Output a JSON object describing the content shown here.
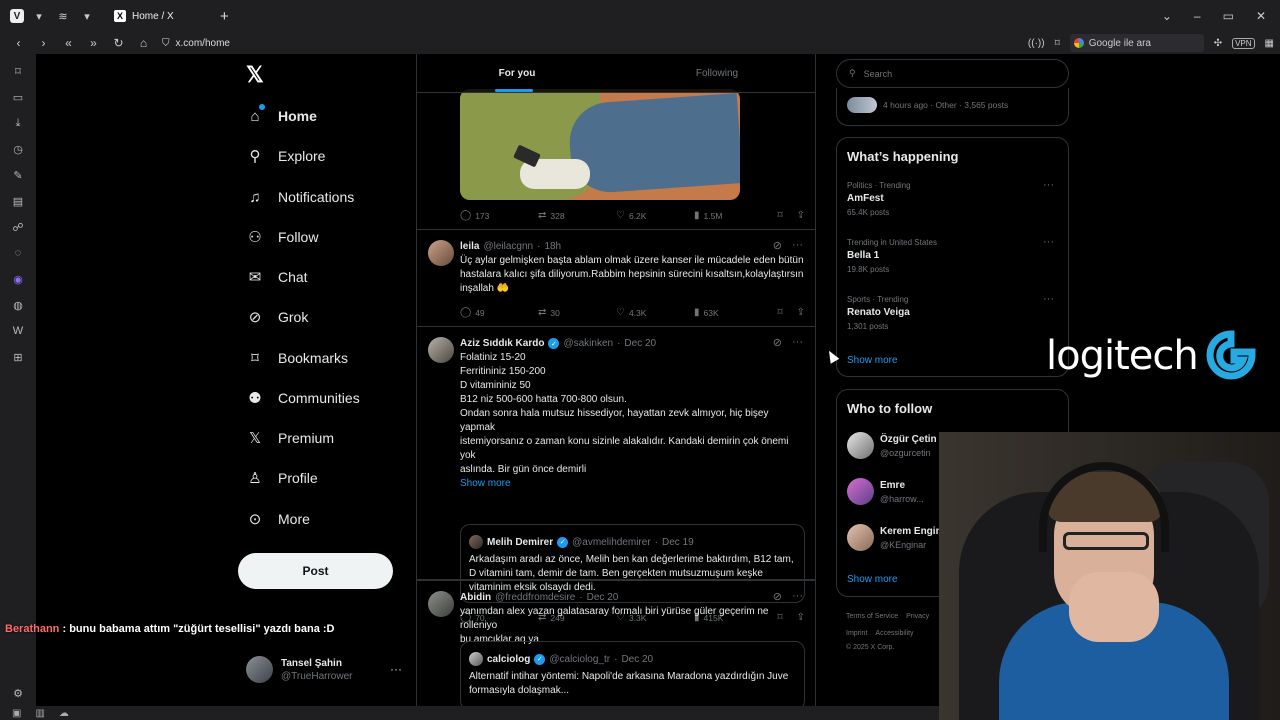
{
  "browser": {
    "tab_title": "Home / X",
    "url": "x.com/home",
    "search_placeholder": "Google ile ara",
    "vpn_label": "VPN"
  },
  "nav": {
    "items": [
      {
        "label": "Home",
        "icon": "home-icon"
      },
      {
        "label": "Explore",
        "icon": "search-icon"
      },
      {
        "label": "Notifications",
        "icon": "bell-icon"
      },
      {
        "label": "Follow",
        "icon": "person-add-icon"
      },
      {
        "label": "Chat",
        "icon": "mail-icon"
      },
      {
        "label": "Grok",
        "icon": "grok-icon"
      },
      {
        "label": "Bookmarks",
        "icon": "bookmark-icon"
      },
      {
        "label": "Communities",
        "icon": "people-icon"
      },
      {
        "label": "Premium",
        "icon": "x-icon"
      },
      {
        "label": "Profile",
        "icon": "person-icon"
      },
      {
        "label": "More",
        "icon": "more-circle-icon"
      }
    ],
    "post_label": "Post",
    "account": {
      "name": "Tansel Şahin",
      "handle": "@TrueHarrower"
    }
  },
  "overlay_chat": {
    "user": "Berathann",
    "sep": " : ",
    "message": "bunu babama attım \"züğürt tesellisi\" yazdı bana :D"
  },
  "feed": {
    "tabs": {
      "for_you": "For you",
      "following": "Following"
    },
    "tweet0": {
      "replies": "173",
      "reposts": "328",
      "likes": "6.2K",
      "views": "1.5M"
    },
    "tweet1": {
      "name": "leila",
      "handle": "@leilacgnn",
      "time": "18h",
      "lines": [
        "Üç aylar gelmişken başta ablam olmak üzere kanser ile mücadele eden bütün",
        "hastalara kalıcı şifa diliyorum.Rabbim hepsinin sürecini kısaltsın,kolaylaştırsın",
        "inşallah 🤲"
      ],
      "replies": "49",
      "reposts": "30",
      "likes": "4.3K",
      "views": "63K"
    },
    "tweet2": {
      "name": "Aziz Sıddık Kardo",
      "handle": "@sakinken",
      "time": "Dec 20",
      "lines": [
        "Folatiniz 15-20",
        "Ferritininiz 150-200",
        "D vitamininiz 50",
        "B12 niz 500-600 hatta 700-800 olsun.",
        "Ondan sonra hala mutsuz hissediyor, hayattan zevk almıyor, hiç bişey yapmak",
        "istemiyorsanız o zaman konu sizinle alakalıdır. Kandaki demirin çok önemi yok",
        "aslında. Bir gün önce demirli"
      ],
      "show_more": "Show more",
      "quote": {
        "name": "Melih Demirer",
        "handle": "@avmelihdemirer",
        "time": "Dec 19",
        "lines": [
          "Arkadaşım aradı az önce, Melih ben kan değerlerime baktırdım, B12 tam,",
          "D vitamini tam, demir de tam. Ben gerçekten mutsuzmuşum keşke",
          "vitaminim eksik olsaydı dedi."
        ]
      },
      "replies": "70",
      "reposts": "249",
      "likes": "3.3K",
      "views": "415K"
    },
    "tweet3": {
      "name": "Abidin",
      "handle": "@freddfromdesire",
      "time": "Dec 20",
      "lines": [
        "yanımdan alex yazan galatasaray formalı biri yürüse güler geçerim ne rolleniyo",
        "bu amcıklar aq ya"
      ],
      "quote": {
        "name": "calciolog",
        "handle": "@calciolog_tr",
        "time": "Dec 20",
        "lines": [
          "Alternatif intihar yöntemi: Napoli'de arkasına Maradona yazdırdığın Juve",
          "formasıyla dolaşmak..."
        ]
      }
    }
  },
  "right": {
    "search_placeholder": "Search",
    "top_card_meta": "4 hours ago · Other · 3,565 posts",
    "happening": {
      "title": "What’s happening",
      "trends": [
        {
          "category": "Politics · Trending",
          "name": "AmFest",
          "posts": "65.4K posts"
        },
        {
          "category": "Trending in United States",
          "name": "Bella 1",
          "posts": "19.8K posts"
        },
        {
          "category": "Sports · Trending",
          "name": "Renato Veiga",
          "posts": "1,301 posts"
        }
      ],
      "show_more": "Show more"
    },
    "who_to_follow": {
      "title": "Who to follow",
      "users": [
        {
          "name": "Özgür Çetin",
          "handle": "@ozgurcetin"
        },
        {
          "name": "Emre",
          "handle": "@harrow..."
        },
        {
          "name": "Kerem Engin",
          "handle": "@KEnginar"
        }
      ],
      "show_more": "Show more"
    },
    "footer": {
      "row1": [
        "Terms of Service",
        "Privacy"
      ],
      "row2": [
        "Imprint",
        "Accessibility"
      ],
      "copyright": "© 2025 X Corp."
    }
  },
  "overlay_logo": {
    "word": "logitech"
  },
  "colors": {
    "accent": "#1d9bf0",
    "background": "#000000",
    "border": "#2f3336",
    "muted": "#71767b"
  }
}
